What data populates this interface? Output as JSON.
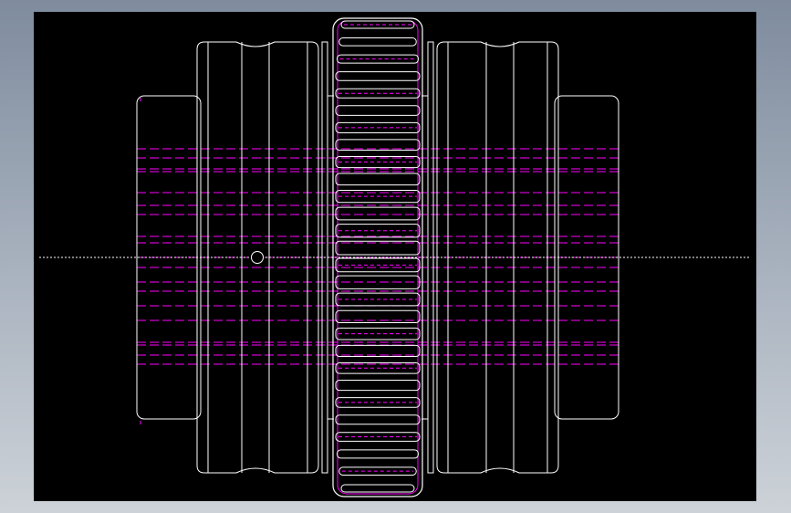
{
  "app": {
    "title": "",
    "view": "front-elevation"
  },
  "drawing": {
    "subject": "gear-coupling-side-view",
    "tooth_count_visible": 28,
    "colors": {
      "outline": "#ffffff",
      "hidden_line": "#ff00ff",
      "center_line": "#ffffff",
      "background": "#000000",
      "frame": "#9aa4b2"
    }
  }
}
